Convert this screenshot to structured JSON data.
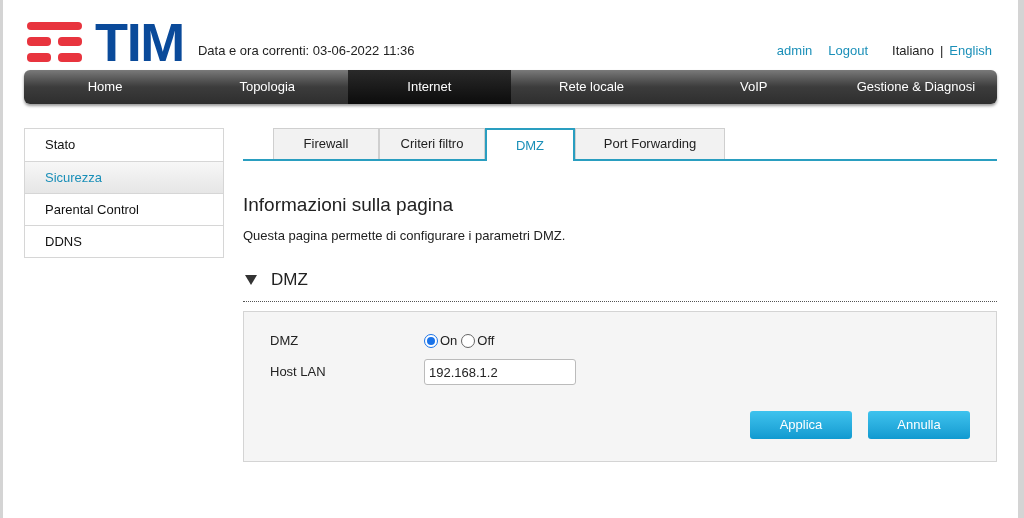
{
  "header": {
    "logo_text": "TIM",
    "datetime": "Data e ora correnti: 03-06-2022 11:36",
    "user_link": "admin",
    "logout_link": "Logout",
    "languages": [
      {
        "label": "Italiano",
        "selected": true
      },
      {
        "label": "English",
        "selected": false
      }
    ],
    "lang_separator": "|"
  },
  "nav": [
    {
      "label": "Home",
      "selected": false
    },
    {
      "label": "Topologia",
      "selected": false
    },
    {
      "label": "Internet",
      "selected": true
    },
    {
      "label": "Rete locale",
      "selected": false
    },
    {
      "label": "VoIP",
      "selected": false
    },
    {
      "label": "Gestione & Diagnosi",
      "selected": false
    }
  ],
  "sidebar": {
    "items": [
      {
        "label": "Stato",
        "selected": false
      },
      {
        "label": "Sicurezza",
        "selected": true
      },
      {
        "label": "Parental Control",
        "selected": false
      },
      {
        "label": "DDNS",
        "selected": false
      }
    ]
  },
  "tabs": [
    {
      "label": "Firewall",
      "selected": false
    },
    {
      "label": "Criteri filtro",
      "selected": false
    },
    {
      "label": "DMZ",
      "selected": true
    },
    {
      "label": "Port Forwarding",
      "selected": false
    }
  ],
  "page_info": {
    "title": "Informazioni sulla pagina",
    "description": "Questa pagina permette di configurare i parametri DMZ."
  },
  "section": {
    "title": "DMZ",
    "expanded": true,
    "fields": [
      {
        "kind": "radio",
        "label": "DMZ",
        "options": [
          {
            "label": "On",
            "selected": true
          },
          {
            "label": "Off",
            "selected": false
          }
        ]
      },
      {
        "kind": "text",
        "label": "Host LAN",
        "value": "192.168.1.2"
      }
    ],
    "buttons": [
      "Applica",
      "Annulla"
    ]
  }
}
